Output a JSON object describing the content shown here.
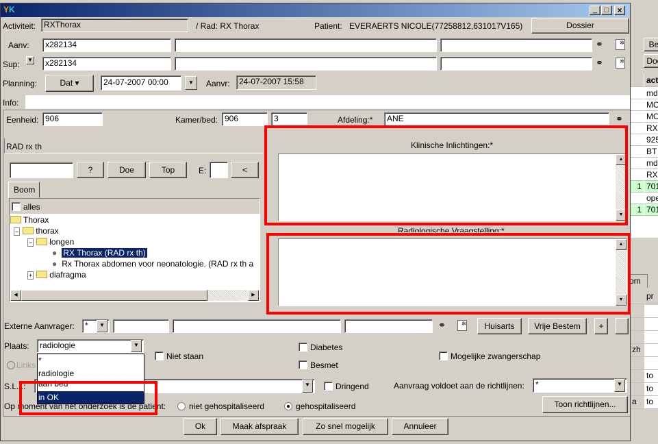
{
  "window": {
    "title": "",
    "buttons": [
      "_",
      "□",
      "×"
    ]
  },
  "header": {
    "activiteit_label": "Activiteit:",
    "activiteit_value": "RXThorax",
    "rad_label": "/   Rad: RX Thorax",
    "patient_label": "Patient:",
    "patient_value": "EVERAERTS NICOLE(77258812,631017V165)",
    "dossier_button": "Dossier"
  },
  "aanv": {
    "label": "Aanv:",
    "value": "x282134"
  },
  "sup": {
    "label": "Sup:",
    "value": "x282134"
  },
  "planning": {
    "label": "Planning:",
    "dat_button": "Dat ▾",
    "date_value": "24-07-2007 00:00",
    "aanvr_label": "Aanvr:",
    "aanvr_value": "24-07-2007 15:58"
  },
  "info": {
    "label": "Info:",
    "value": ""
  },
  "eenheid": {
    "label": "Eenheid:",
    "value": "906",
    "kamer_label": "Kamer/bed:",
    "kamer_value": "906",
    "bed_value": "3",
    "afdeling_label": "Afdeling:*",
    "afdeling_value": "ANE"
  },
  "tree_panel": {
    "title": "RAD rx th",
    "search_value": "",
    "q_button": "?",
    "doe_button": "Doe",
    "top_button": "Top",
    "e_label": "E:",
    "e_value": "",
    "back_button": "<",
    "tab": "Boom",
    "alles_label": "alles",
    "nodes": [
      "Thorax",
      "thorax",
      "longen",
      "RX Thorax (RAD rx th)",
      "Rx Thorax abdomen voor neonatologie. (RAD rx th a",
      "diafragma"
    ]
  },
  "klinische": {
    "label": "Klinische Inlichtingen:*",
    "value": ""
  },
  "radiologische": {
    "label": "Radiologische Vraagstelling:*",
    "value": ""
  },
  "externe": {
    "label": "Externe Aanvrager:",
    "select_value": "*",
    "huisarts_button": "Huisarts",
    "vrije_button": "Vrije Bestem",
    "plus_button": "+"
  },
  "plaats": {
    "label": "Plaats:",
    "value": "radiologie",
    "options": [
      "*",
      "radiologie",
      "aan bed",
      "in OK"
    ],
    "highlighted": "in OK"
  },
  "checkboxes": {
    "niet_staan": "Niet staan",
    "diabetes": "Diabetes",
    "besmet": "Besmet",
    "zwanger": "Mogelijke zwangerschap",
    "dringend": "Dringend"
  },
  "links_label": "Links",
  "sl_label": "S.L...:",
  "richtlijnen": {
    "label": "Aanvraag voldoet aan de richtlijnen:",
    "value": "*",
    "toon_button": "Toon richtlijnen..."
  },
  "hospital": {
    "label": "Op moment van het onderzoek is de patient:",
    "option1": "niet gehospitaliseerd",
    "option2": "gehospitaliseerd",
    "selected": "gehospitaliseerd"
  },
  "footer": {
    "ok": "Ok",
    "afspraak": "Maak afspraak",
    "snel": "Zo snel mogelijk",
    "annuleer": "Annuleer"
  },
  "background_app": {
    "btn1": "Be",
    "btn2": "Doc",
    "col_header": "act",
    "rows": [
      {
        "n": "",
        "v": "md"
      },
      {
        "n": "",
        "v": "MO"
      },
      {
        "n": "",
        "v": "MO"
      },
      {
        "n": "",
        "v": "RX"
      },
      {
        "n": "",
        "v": "925"
      },
      {
        "n": "",
        "v": "BT"
      },
      {
        "n": "",
        "v": "md"
      },
      {
        "n": "",
        "v": "RX"
      },
      {
        "n": "1",
        "v": "701",
        "green": true
      },
      {
        "n": "",
        "v": "ope"
      },
      {
        "n": "1",
        "v": "701",
        "green": true
      }
    ],
    "tab": "om",
    "col2_header": "pr",
    "lower_rows": [
      {
        "a": "",
        "b": ""
      },
      {
        "a": "",
        "b": ""
      },
      {
        "a": "",
        "b": ""
      },
      {
        "a": "zh",
        "b": ""
      },
      {
        "a": "",
        "b": ""
      },
      {
        "a": "",
        "b": "to"
      },
      {
        "a": "",
        "b": "to"
      },
      {
        "a": "a",
        "b": "to"
      }
    ]
  },
  "colors": {
    "highlight": "#0a246a",
    "annotation": "#ff0000",
    "green_row": "#ccffcc"
  }
}
